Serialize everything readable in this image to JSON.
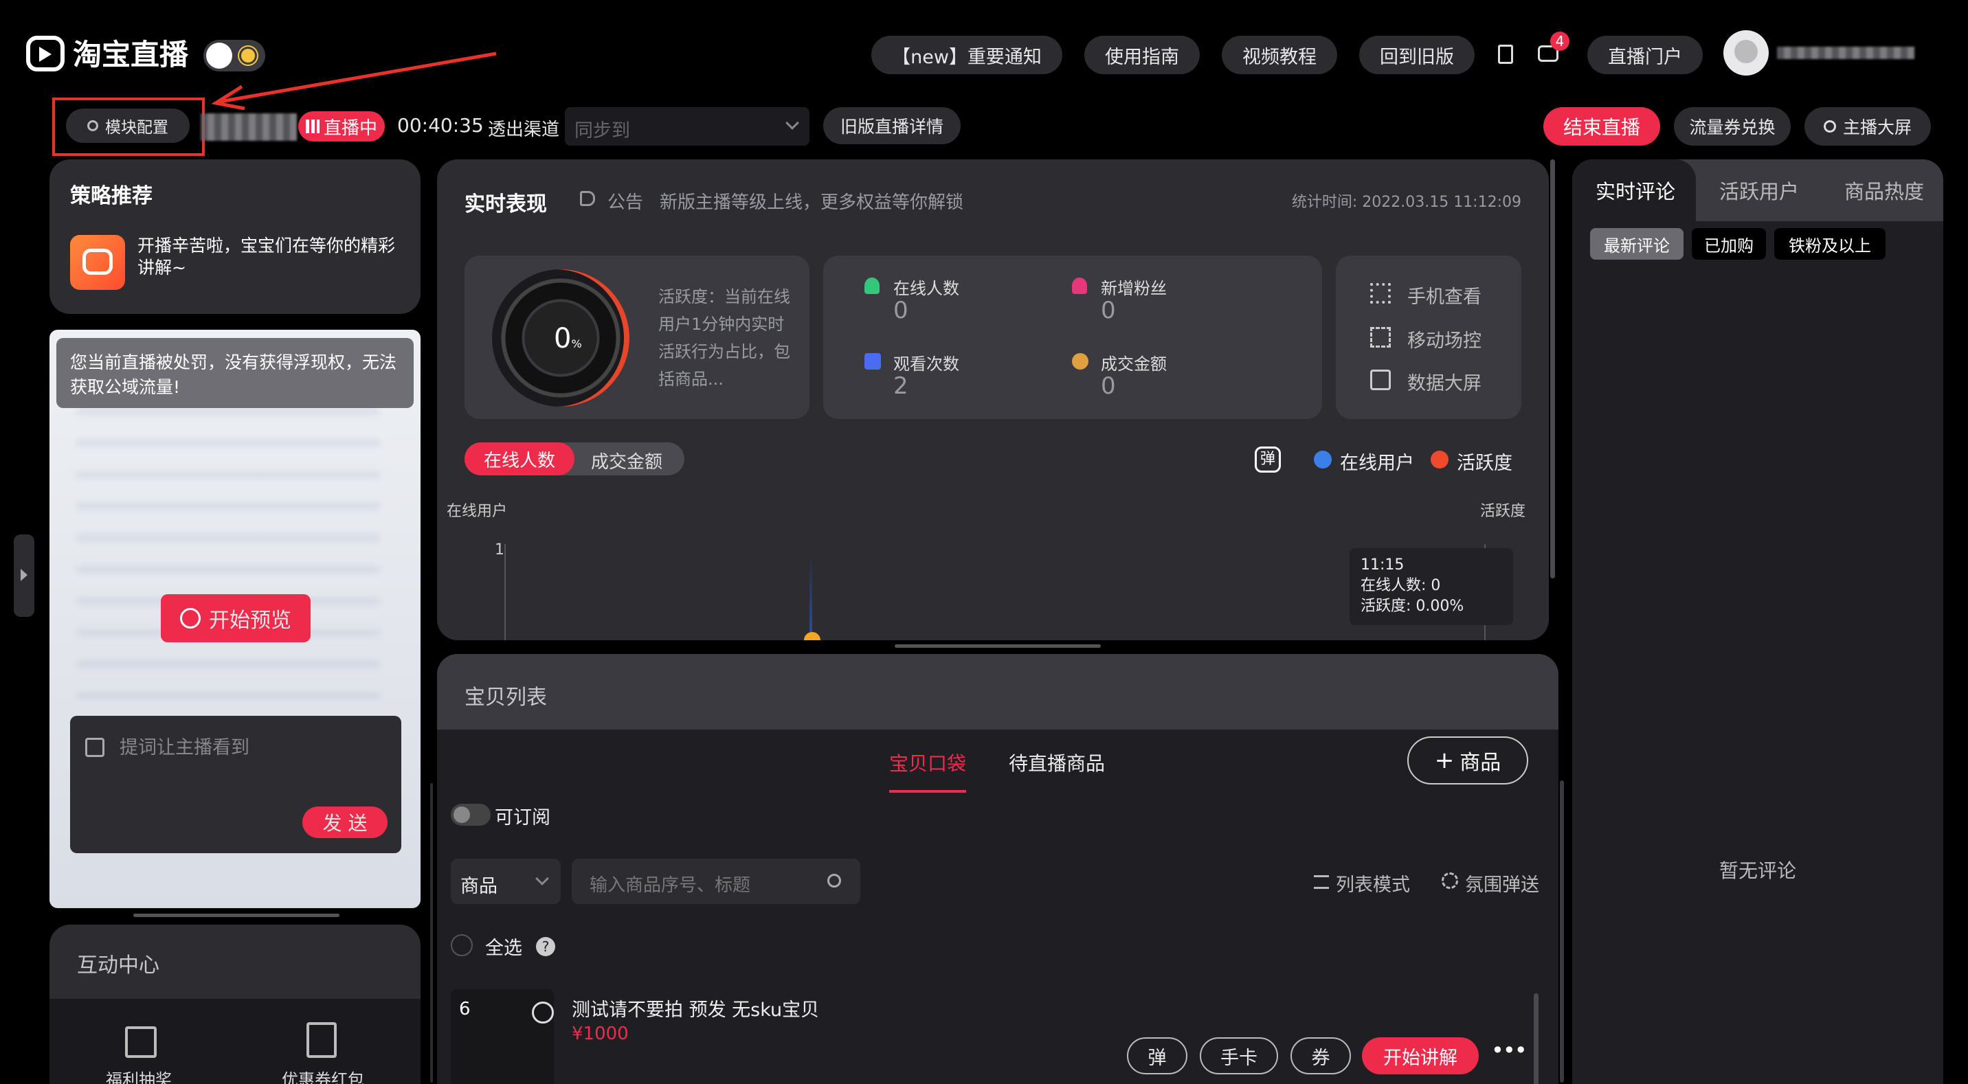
{
  "app": {
    "logo_text": "淘宝直播"
  },
  "header": {
    "buttons": [
      "【new】重要通知",
      "使用指南",
      "视频教程",
      "回到旧版"
    ],
    "notification_count": "4",
    "portal": "直播门户"
  },
  "toolbar": {
    "module_config": "模块配置",
    "live_badge": "直播中",
    "timer": "00:40:35",
    "channel_label": "透出渠道",
    "sync_placeholder": "同步到",
    "old_detail": "旧版直播详情",
    "end_live": "结束直播",
    "traffic_coupon": "流量券兑换",
    "anchor_screen": "主播大屏"
  },
  "strategy": {
    "title": "策略推荐",
    "message": "开播辛苦啦，宝宝们在等你的精彩讲解~"
  },
  "preview": {
    "warning": "您当前直播被处罚，没有获得浮现权，无法获取公域流量!",
    "start_preview": "开始预览",
    "prompt_placeholder": "提词让主播看到",
    "send": "发 送"
  },
  "interaction": {
    "title": "互动中心",
    "items": [
      "福利抽奖",
      "优惠券红包"
    ]
  },
  "realtime": {
    "title": "实时表现",
    "notice_label": "公告",
    "notice_text": "新版主播等级上线，更多权益等你解锁",
    "stat_time": "统计时间: 2022.03.15 11:12:09",
    "gauge_value": "0",
    "gauge_unit": "%",
    "activity_desc": "活跃度：当前在线用户1分钟内实时活跃行为占比，包括商品...",
    "stats": [
      {
        "label": "在线人数",
        "value": "0"
      },
      {
        "label": "新增粉丝",
        "value": "0"
      },
      {
        "label": "观看次数",
        "value": "2"
      },
      {
        "label": "成交金额",
        "value": "0"
      }
    ],
    "tools": [
      "手机查看",
      "移动场控",
      "数据大屏"
    ],
    "toggle": [
      "在线人数",
      "成交金额"
    ],
    "danmu": "弹",
    "legend": [
      "在线用户",
      "活跃度"
    ],
    "y_left_label": "在线用户",
    "y_right_label": "活跃度",
    "y_tick": "1",
    "tooltip": {
      "time": "11:15",
      "line1": "在线人数: 0",
      "line2": "活跃度: 0.00%"
    }
  },
  "products": {
    "title": "宝贝列表",
    "tabs": [
      "宝贝口袋",
      "待直播商品"
    ],
    "add_button": "商品",
    "subscribe": "可订阅",
    "category": "商品",
    "search_placeholder": "输入商品序号、标题",
    "list_mode": "列表模式",
    "atmosphere": "氛围弹送",
    "select_all": "全选",
    "items": [
      {
        "index": "6",
        "title": "测试请不要拍 预发 无sku宝贝",
        "price": "¥1000",
        "actions": [
          "弹",
          "手卡",
          "券"
        ],
        "explain": "开始讲解"
      }
    ]
  },
  "right": {
    "tabs": [
      "实时评论",
      "活跃用户",
      "商品热度"
    ],
    "filters": [
      "最新评论",
      "已加购",
      "铁粉及以上"
    ],
    "empty": "暂无评论"
  },
  "colors": {
    "accent": "#ee2b4a",
    "bg": "#000000",
    "panel": "#2c2c31",
    "card": "#3a3a40"
  }
}
